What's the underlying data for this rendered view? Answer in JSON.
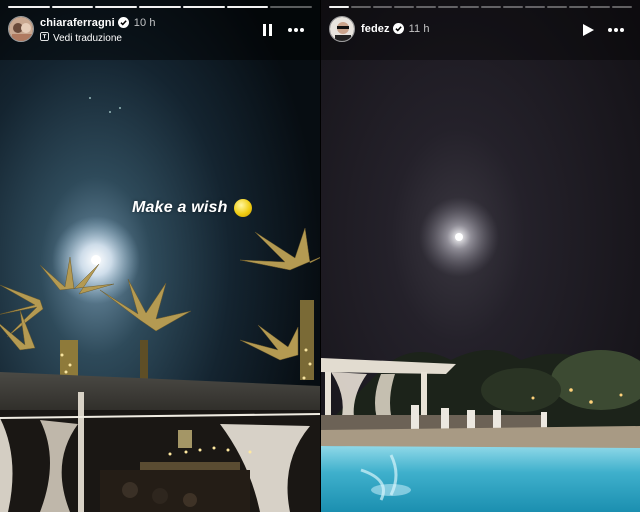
{
  "stories": [
    {
      "username": "chiaraferragni",
      "time": "10 h",
      "translate_link": "Vedi traduzione",
      "caption": "Make a wish",
      "caption_emoji": "full-moon-emoji",
      "playback_icon": "pause-icon",
      "menu_icon": "more-icon",
      "progress_segments": 7,
      "progress_done": 6
    },
    {
      "username": "fedez",
      "time": "11 h",
      "playback_icon": "play-icon",
      "menu_icon": "more-icon",
      "progress_segments": 14,
      "progress_done": 1
    }
  ]
}
